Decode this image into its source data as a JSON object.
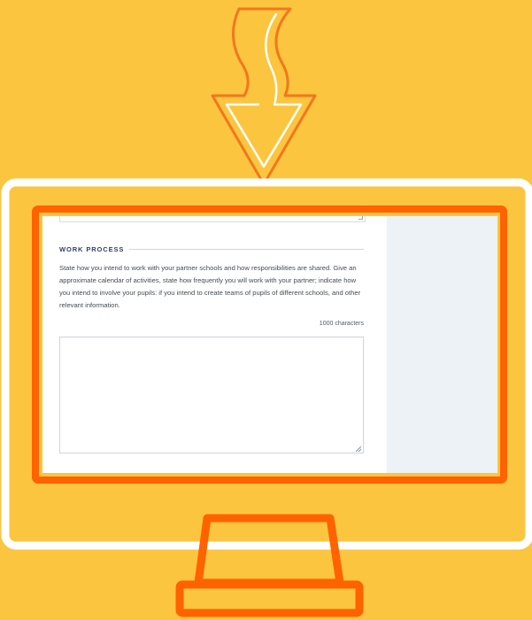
{
  "colors": {
    "background": "#fcc53f",
    "monitor_frame": "#ff6200",
    "arrow_outline": "#f2771c",
    "screen_sidebar": "#edf2f6",
    "section_title": "#2f3e6b"
  },
  "icons": {
    "arrow": "curved-down-arrow-icon",
    "monitor": "monitor-icon"
  },
  "form": {
    "section_title": "WORK PROCESS",
    "description": "State how you intend to work with your partner schools and how responsibilities are shared. Give an approximate calendar of activities, state how frequently you will work with your partner; indicate how you intend to involve your pupils: if you intend to create teams of pupils of different schools, and other relevant information.",
    "char_limit": "1000 characters",
    "textarea_value": ""
  }
}
